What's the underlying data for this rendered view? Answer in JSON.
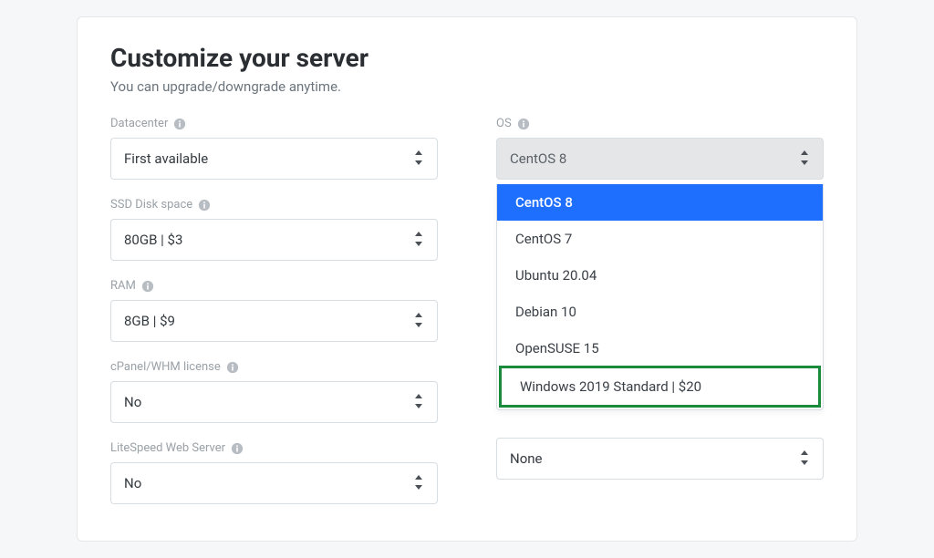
{
  "header": {
    "title": "Customize your server",
    "subtitle": "You can upgrade/downgrade anytime."
  },
  "left": {
    "datacenter": {
      "label": "Datacenter",
      "value": "First available"
    },
    "ssd": {
      "label": "SSD Disk space",
      "value": "80GB | $3"
    },
    "ram": {
      "label": "RAM",
      "value": "8GB | $9"
    },
    "cpanel": {
      "label": "cPanel/WHM license",
      "value": "No"
    },
    "litespeed": {
      "label": "LiteSpeed Web Server",
      "value": "No"
    }
  },
  "right": {
    "os": {
      "label": "OS",
      "value": "CentOS 8"
    },
    "cpanel_right": {
      "value": "None"
    }
  },
  "os_options": [
    "CentOS 8",
    "CentOS 7",
    "Ubuntu 20.04",
    "Debian 10",
    "OpenSUSE 15",
    "Windows 2019 Standard | $20"
  ]
}
